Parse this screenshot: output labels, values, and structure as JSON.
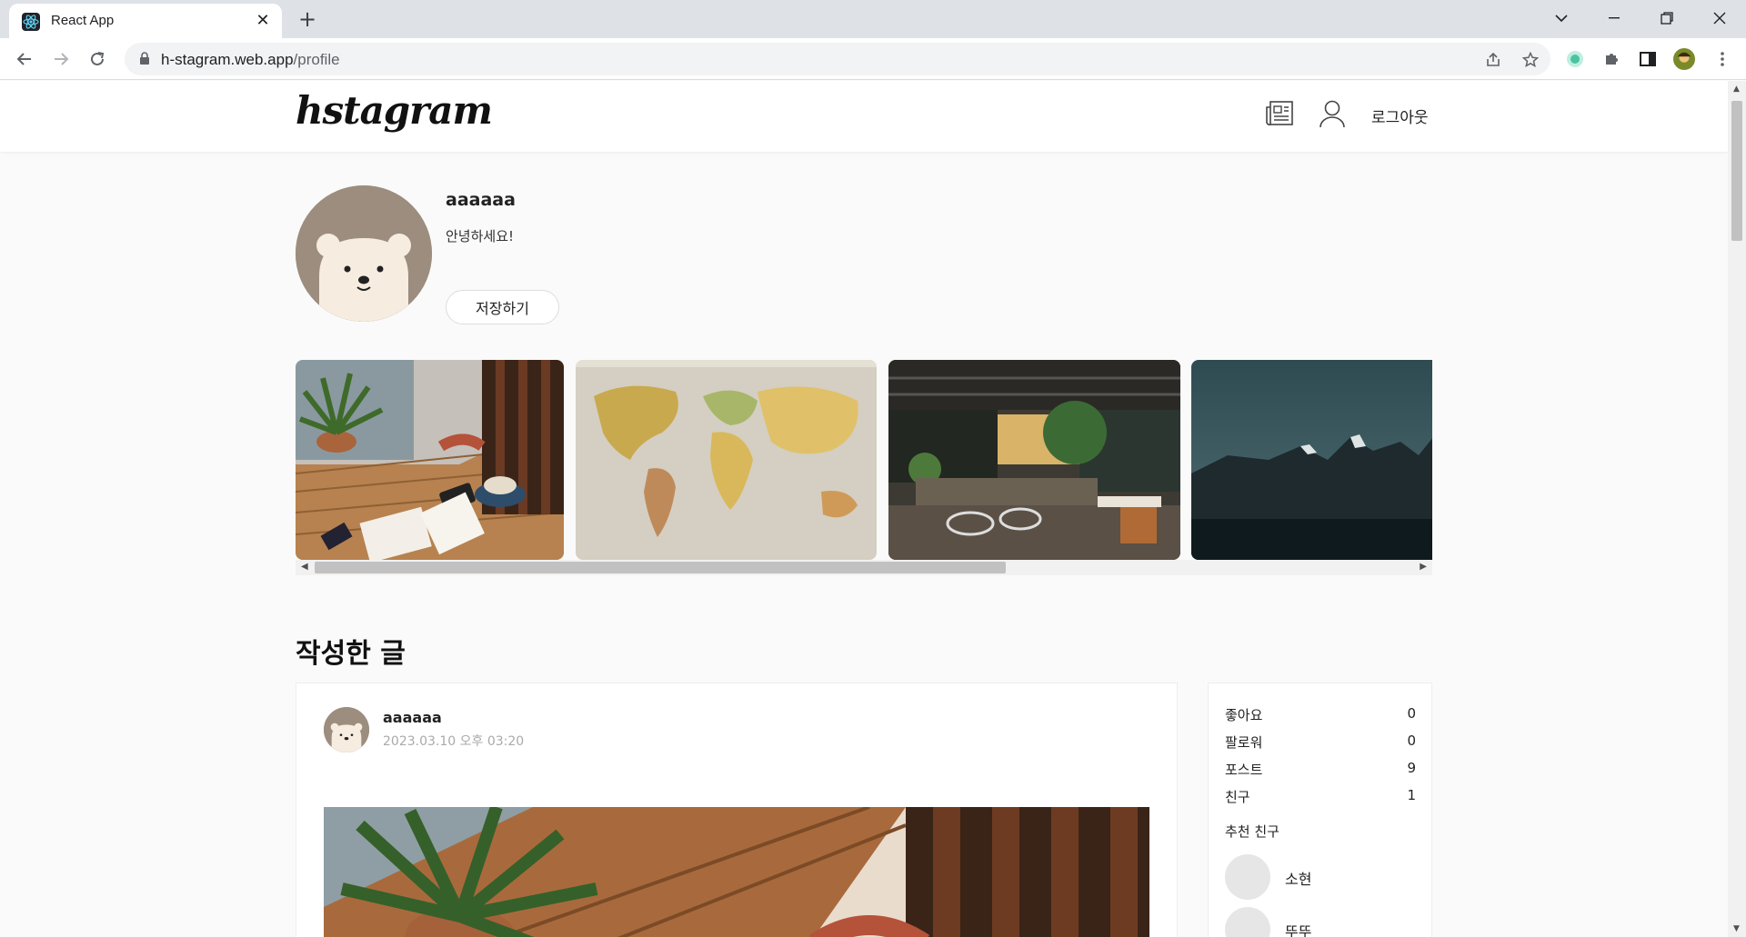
{
  "browser": {
    "tab_title": "React App",
    "url_host": "h-stagram.web.app",
    "url_path": "/profile"
  },
  "header": {
    "logo": "hstagram",
    "logout_label": "로그아웃"
  },
  "profile": {
    "username": "aaaaaa",
    "bio": "안녕하세요!",
    "save_label": "저장하기"
  },
  "gallery": {
    "images": [
      "cafe-table-photo",
      "world-map-photo",
      "cafe-interior-photo",
      "mountain-photo"
    ]
  },
  "posts_section": {
    "title": "작성한 글",
    "posts": [
      {
        "username": "aaaaaa",
        "date": "2023.03.10 오후 03:20"
      }
    ]
  },
  "stats": {
    "items": [
      {
        "label": "좋아요",
        "value": "0"
      },
      {
        "label": "팔로워",
        "value": "0"
      },
      {
        "label": "포스트",
        "value": "9"
      },
      {
        "label": "친구",
        "value": "1"
      }
    ],
    "recommend_title": "추천 친구",
    "friends": [
      {
        "name": "소현"
      },
      {
        "name": "뚜뚜"
      }
    ]
  },
  "colors": {
    "avatar_bg": "#9c8d7e",
    "page_bg": "#fafafa"
  }
}
